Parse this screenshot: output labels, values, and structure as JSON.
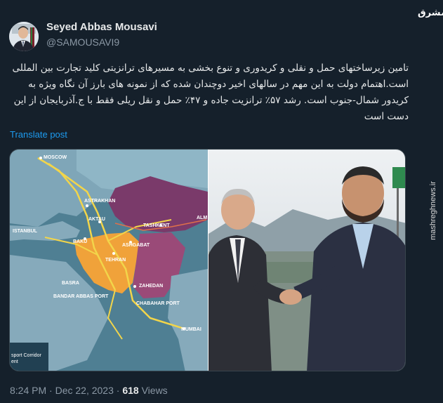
{
  "author": {
    "name": "Seyed Abbas Mousavi",
    "handle": "@SAMOUSAVI9"
  },
  "brand": {
    "logo": "مشرق",
    "url": "mashreghnews.ir"
  },
  "tweet": {
    "text": "تامین زیرساختهای حمل و نقلی و کریدوری و تنوع بخشی به مسیرهای ترانزیتی کلید تجارت بین المللی است.اهتمام دولت به این مهم در سالهای اخیر دوچندان شده که از نمونه های بارز آن نگاه ویژه به کریدور شمال-جنوب است. رشد ۵۷٪ ترانزیت جاده و ۴۷٪ حمل و نقل ریلی فقط با ج.آذربایجان از این دست است",
    "translate_label": "Translate post"
  },
  "map": {
    "cities": {
      "moscow": "MOSCOW",
      "astrakhan": "ASTRAKHAN",
      "aktau": "AKTAU",
      "tashkent": "TASHKENT",
      "almaty": "ALM",
      "istanbul": "ISTANBUL",
      "baku": "BAKU",
      "ashgabat": "ASHGABAT",
      "tehran": "TEHRAN",
      "basra": "BASRA",
      "zahedan": "ZAHEDAN",
      "bandar_abbas": "BANDAR ABBAS PORT",
      "chabahar": "CHABAHAR PORT",
      "mumbai": "MUMBAI"
    },
    "legend": "sport Corridor\nent"
  },
  "meta": {
    "time": "8:24 PM",
    "date": "Dec 22, 2023",
    "views_count": "618",
    "views_label": "Views",
    "separator": "·"
  }
}
